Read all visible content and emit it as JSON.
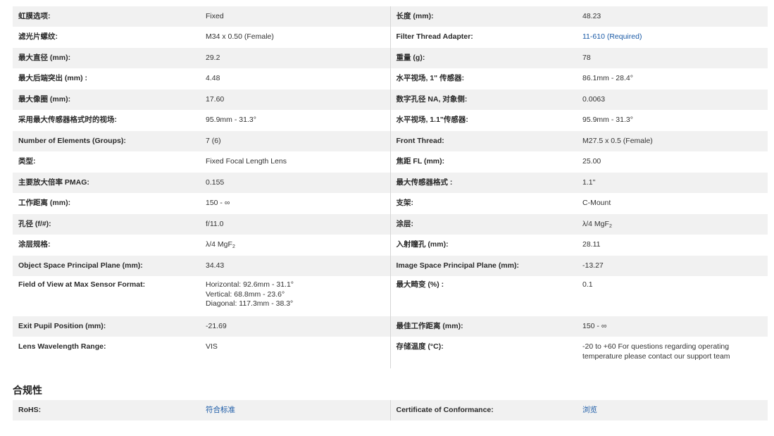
{
  "specs": [
    {
      "l1": "虹膜选项:",
      "v1": "Fixed",
      "l2": "长度 (mm):",
      "v2": "48.23"
    },
    {
      "l1": "滤光片螺纹:",
      "v1": "M34 x 0.50 (Female)",
      "l2": "Filter Thread Adapter:",
      "v2": "11-610 (Required)"
    },
    {
      "l1": "最大直径 (mm):",
      "v1": "29.2",
      "l2": "重量 (g):",
      "v2": "78"
    },
    {
      "l1": "最大后端突出 (mm) :",
      "v1": "4.48",
      "l2": "水平视场, 1\" 传感器:",
      "v2": "86.1mm - 28.4°"
    },
    {
      "l1": "最大像圈 (mm):",
      "v1": "17.60",
      "l2": "数字孔径 NA, 对象侧:",
      "v2": "0.0063"
    },
    {
      "l1": "采用最大传感器格式时的视场:",
      "v1": "95.9mm - 31.3°",
      "l2": "水平视场, 1.1\"传感器:",
      "v2": "95.9mm - 31.3°"
    },
    {
      "l1": "Number of Elements (Groups):",
      "v1": "7 (6)",
      "l2": "Front Thread:",
      "v2": "M27.5 x 0.5 (Female)"
    },
    {
      "l1": "类型:",
      "v1": "Fixed Focal Length Lens",
      "l2": "焦距 FL (mm):",
      "v2": "25.00"
    },
    {
      "l1": "主要放大倍率 PMAG:",
      "v1": "0.155",
      "l2": "最大传感器格式 :",
      "v2": "1.1\""
    },
    {
      "l1": "工作距离 (mm):",
      "v1": "150 - ∞",
      "l2": "支架:",
      "v2": "C-Mount"
    },
    {
      "l1": "孔径 (f/#):",
      "v1": "f/11.0",
      "l2": "涂层:",
      "v2": "λ/4 MgF",
      "v2_sub": "2"
    },
    {
      "l1": "涂层规格:",
      "v1": "λ/4 MgF",
      "v1_sub": "2",
      "l2": "入射瞳孔 (mm):",
      "v2": "28.11"
    },
    {
      "l1": "Object Space Principal Plane (mm):",
      "v1": "34.43",
      "l2": "Image Space Principal Plane (mm):",
      "v2": "-13.27"
    },
    {
      "l1": "Field of View at Max Sensor Format:",
      "v1_lines": [
        "Horizontal: 92.6mm - 31.1°",
        "Vertical: 68.8mm - 23.6°",
        "Diagonal: 117.3mm - 38.3°"
      ],
      "l2": "最大畸变 (%) :",
      "v2": "0.1"
    },
    {
      "l1": "Exit Pupil Position (mm):",
      "v1": "-21.69",
      "l2": "最佳工作距离 (mm):",
      "v2": "150 - ∞"
    },
    {
      "l1": "Lens Wavelength Range:",
      "v1": "VIS",
      "l2": "存储温度 (°C):",
      "v2_lines": [
        "-20 to +60 For questions regarding operating",
        "temperature please contact our support team"
      ]
    }
  ],
  "compliance": {
    "title": "合规性",
    "l1": "RoHS:",
    "v1": "符合标准",
    "l2": "Certificate of Conformance:",
    "v2": "浏览"
  }
}
